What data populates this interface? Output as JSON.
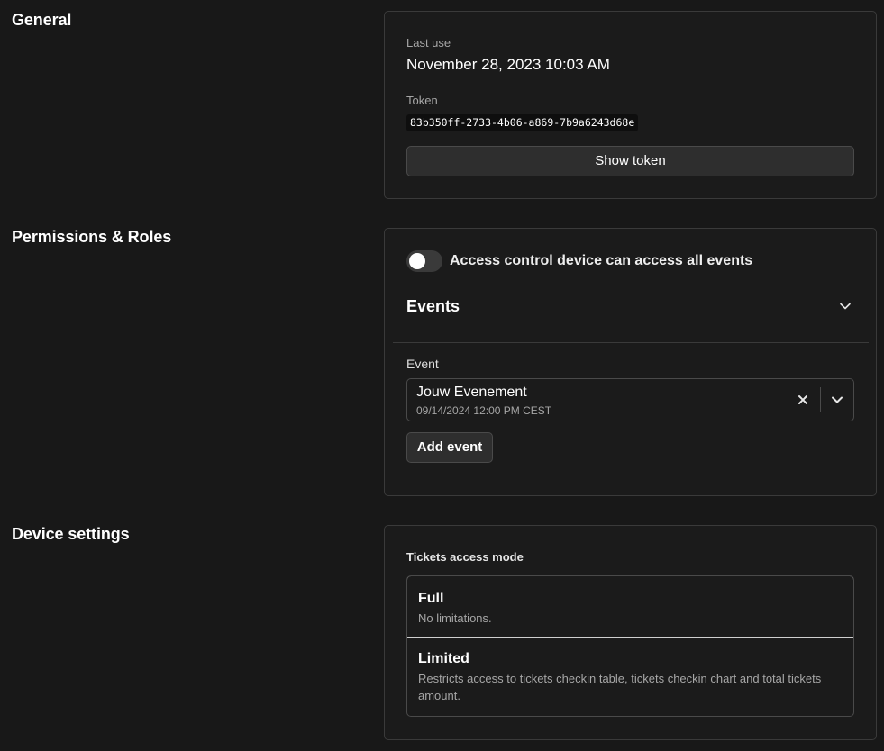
{
  "general": {
    "title": "General",
    "last_use_label": "Last use",
    "last_use_value": "November 28, 2023 10:03 AM",
    "token_label": "Token",
    "token_value": "83b350ff-2733-4b06-a869-7b9a6243d68e",
    "show_token_label": "Show token"
  },
  "permissions": {
    "title": "Permissions & Roles",
    "toggle_label": "Access control device can access all events",
    "toggle_on": false,
    "events_header": "Events",
    "event_field_label": "Event",
    "selected_event": {
      "name": "Jouw Evenement",
      "date": "09/14/2024 12:00 PM CEST"
    },
    "add_event_label": "Add event"
  },
  "device_settings": {
    "title": "Device settings",
    "access_mode_label": "Tickets access mode",
    "options": [
      {
        "title": "Full",
        "description": "No limitations.",
        "selected": true
      },
      {
        "title": "Limited",
        "description": "Restricts access to tickets checkin table, tickets checkin chart and total tickets amount.",
        "selected": false
      }
    ]
  },
  "icons": {
    "chevron": "chevron-down-icon",
    "clear": "close-icon"
  },
  "colors": {
    "background": "#181818",
    "card_border": "#3a3a3a",
    "muted_text": "#a6a6a6"
  }
}
